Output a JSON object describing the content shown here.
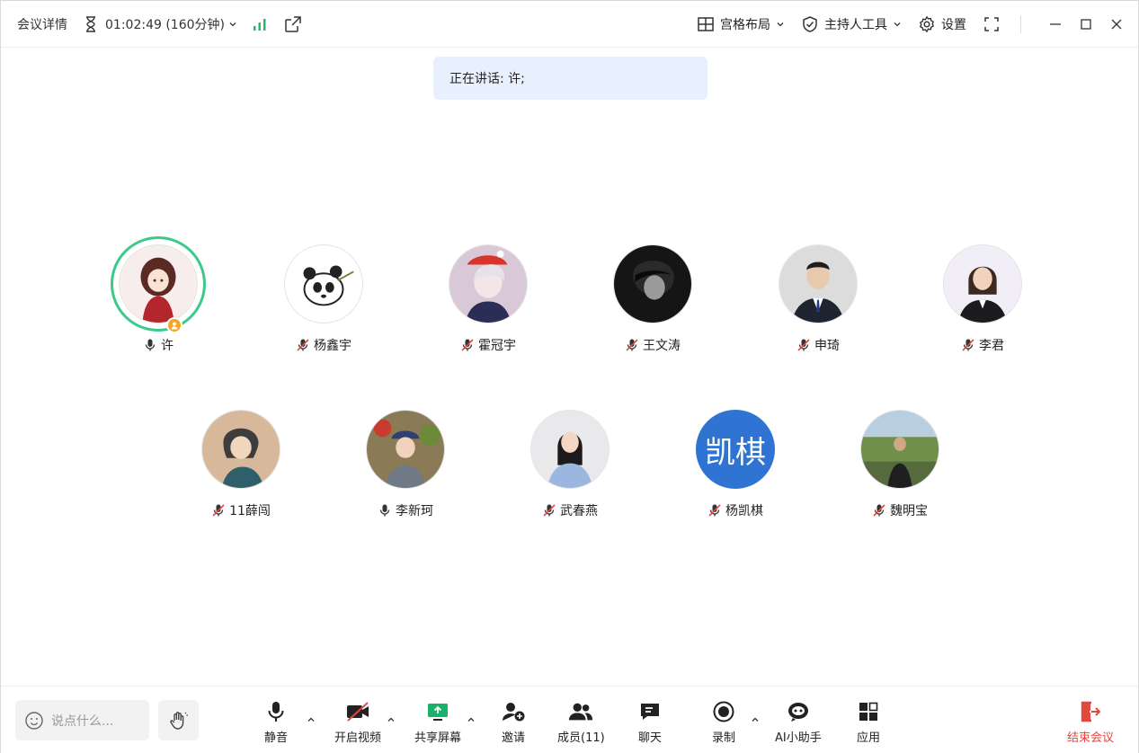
{
  "topbar": {
    "details_label": "会议详情",
    "timer": "01:02:49 (160分钟)",
    "layout_label": "宫格布局",
    "host_tools_label": "主持人工具",
    "settings_label": "设置"
  },
  "banner": {
    "speaking_text": "正在讲话: 许;"
  },
  "participants": [
    {
      "name": "许",
      "muted": false,
      "active": true,
      "host": true
    },
    {
      "name": "杨鑫宇",
      "muted": true
    },
    {
      "name": "霍冠宇",
      "muted": true
    },
    {
      "name": "王文涛",
      "muted": true
    },
    {
      "name": "申琦",
      "muted": true
    },
    {
      "name": "李君",
      "muted": true
    },
    {
      "name": "11薛闯",
      "muted": true
    },
    {
      "name": "李新珂",
      "muted": false
    },
    {
      "name": "武春燕",
      "muted": true
    },
    {
      "name": "杨凯棋",
      "muted": true,
      "initials": "凯棋"
    },
    {
      "name": "魏明宝",
      "muted": true
    }
  ],
  "bottombar": {
    "chat_placeholder": "说点什么...",
    "mute_label": "静音",
    "video_label": "开启视频",
    "share_label": "共享屏幕",
    "invite_label": "邀请",
    "members_label": "成员(11)",
    "chat_label": "聊天",
    "record_label": "录制",
    "ai_label": "AI小助手",
    "apps_label": "应用",
    "end_label": "结束会议"
  },
  "colors": {
    "active_ring": "#3cc98a",
    "signal": "#2db56c",
    "share_green": "#1ab26b",
    "end_red": "#e2483d",
    "banner_bg": "#e8f0fd",
    "text_avatar_bg": "#2f73d3"
  }
}
